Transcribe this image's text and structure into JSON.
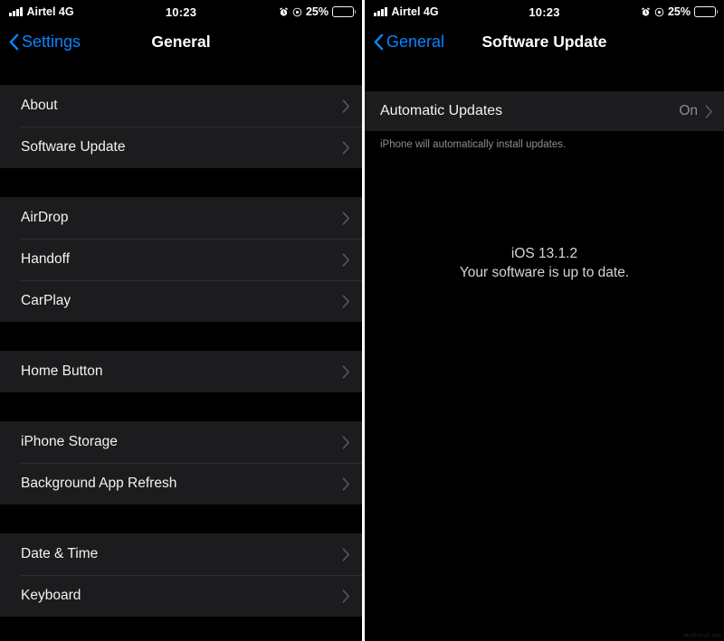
{
  "status_bar": {
    "carrier": "Airtel 4G",
    "signal_icon": "cellular-signal-icon",
    "time": "10:23",
    "alarm_icon": "alarm-clock-icon",
    "lock_rotation_icon": "orientation-lock-icon",
    "battery_percent": "25%",
    "battery_level": 25,
    "battery_icon": "battery-icon"
  },
  "left_screen": {
    "nav": {
      "back_label": "Settings",
      "back_icon": "chevron-left-icon",
      "title": "General"
    },
    "groups": [
      {
        "rows": [
          {
            "label": "About",
            "value": "",
            "disclosure": "chevron-right-icon"
          },
          {
            "label": "Software Update",
            "value": "",
            "disclosure": "chevron-right-icon"
          }
        ]
      },
      {
        "rows": [
          {
            "label": "AirDrop",
            "value": "",
            "disclosure": "chevron-right-icon"
          },
          {
            "label": "Handoff",
            "value": "",
            "disclosure": "chevron-right-icon"
          },
          {
            "label": "CarPlay",
            "value": "",
            "disclosure": "chevron-right-icon"
          }
        ]
      },
      {
        "rows": [
          {
            "label": "Home Button",
            "value": "",
            "disclosure": "chevron-right-icon"
          }
        ]
      },
      {
        "rows": [
          {
            "label": "iPhone Storage",
            "value": "",
            "disclosure": "chevron-right-icon"
          },
          {
            "label": "Background App Refresh",
            "value": "",
            "disclosure": "chevron-right-icon"
          }
        ]
      },
      {
        "rows": [
          {
            "label": "Date & Time",
            "value": "",
            "disclosure": "chevron-right-icon"
          },
          {
            "label": "Keyboard",
            "value": "",
            "disclosure": "chevron-right-icon"
          }
        ]
      }
    ]
  },
  "right_screen": {
    "nav": {
      "back_label": "General",
      "back_icon": "chevron-left-icon",
      "title": "Software Update"
    },
    "automatic_updates": {
      "label": "Automatic Updates",
      "value": "On",
      "disclosure": "chevron-right-icon",
      "footer": "iPhone will automatically install updates."
    },
    "body": {
      "version": "iOS 13.1.2",
      "status": "Your software is up to date."
    }
  },
  "colors": {
    "accent_blue": "#0a84ff",
    "row_background": "#1c1c1e",
    "screen_background": "#000000",
    "secondary_text": "#8e8e93"
  },
  "watermark": "techviral.net"
}
